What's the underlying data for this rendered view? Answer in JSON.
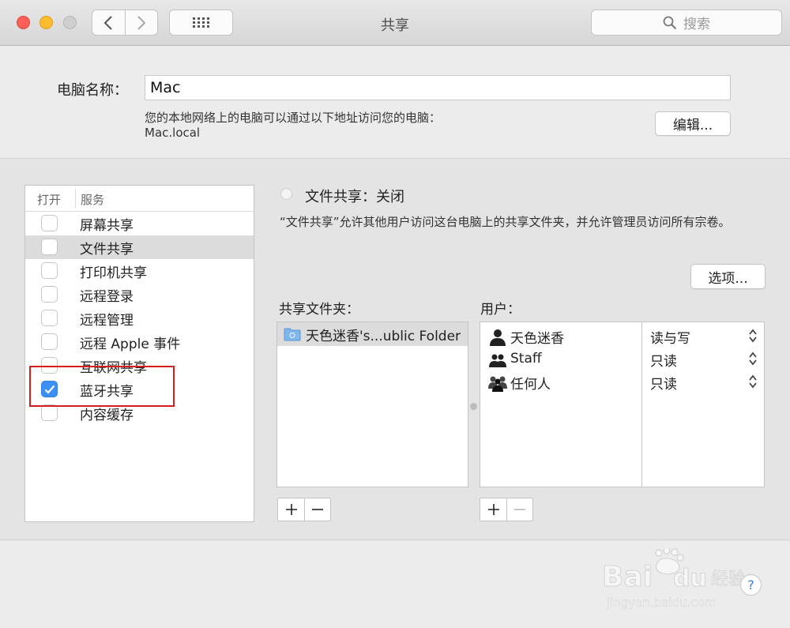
{
  "window": {
    "title": "共享"
  },
  "search": {
    "placeholder": "搜索"
  },
  "computer_name": {
    "label": "电脑名称：",
    "value": "Mac",
    "description": "您的本地网络上的电脑可以通过以下地址访问您的电脑：",
    "address": "Mac.local",
    "edit_label": "编辑..."
  },
  "services": {
    "header_on": "打开",
    "header_service": "服务",
    "items": [
      {
        "label": "屏幕共享",
        "checked": false
      },
      {
        "label": "文件共享",
        "checked": false
      },
      {
        "label": "打印机共享",
        "checked": false
      },
      {
        "label": "远程登录",
        "checked": false
      },
      {
        "label": "远程管理",
        "checked": false
      },
      {
        "label": "远程 Apple 事件",
        "checked": false
      },
      {
        "label": "互联网共享",
        "checked": false
      },
      {
        "label": "蓝牙共享",
        "checked": true
      },
      {
        "label": "内容缓存",
        "checked": false
      }
    ],
    "selected_index": 1,
    "highlight_color": "#d41f1f"
  },
  "detail": {
    "status": "文件共享：关闭",
    "description": "“文件共享”允许其他用户访问这台电脑上的共享文件夹，并允许管理员访问所有宗卷。",
    "options_label": "选项...",
    "shared_folders_label": "共享文件夹：",
    "users_label": "用户：",
    "folders": [
      {
        "name": "天色迷香's...ublic Folder"
      }
    ],
    "users": [
      {
        "name": "天色迷香",
        "permission": "读与写",
        "icon": "single-user-icon"
      },
      {
        "name": "Staff",
        "permission": "只读",
        "icon": "group-users-icon"
      },
      {
        "name": "任何人",
        "permission": "只读",
        "icon": "everyone-users-icon"
      }
    ]
  },
  "watermark": {
    "brand": "Bai du 经验",
    "url": "jingyan.baidu.com"
  },
  "help": {
    "label": "?"
  },
  "colors": {
    "accent": "#3b8ff5",
    "close": "#fc5f57",
    "minimize": "#fdbc2e"
  }
}
